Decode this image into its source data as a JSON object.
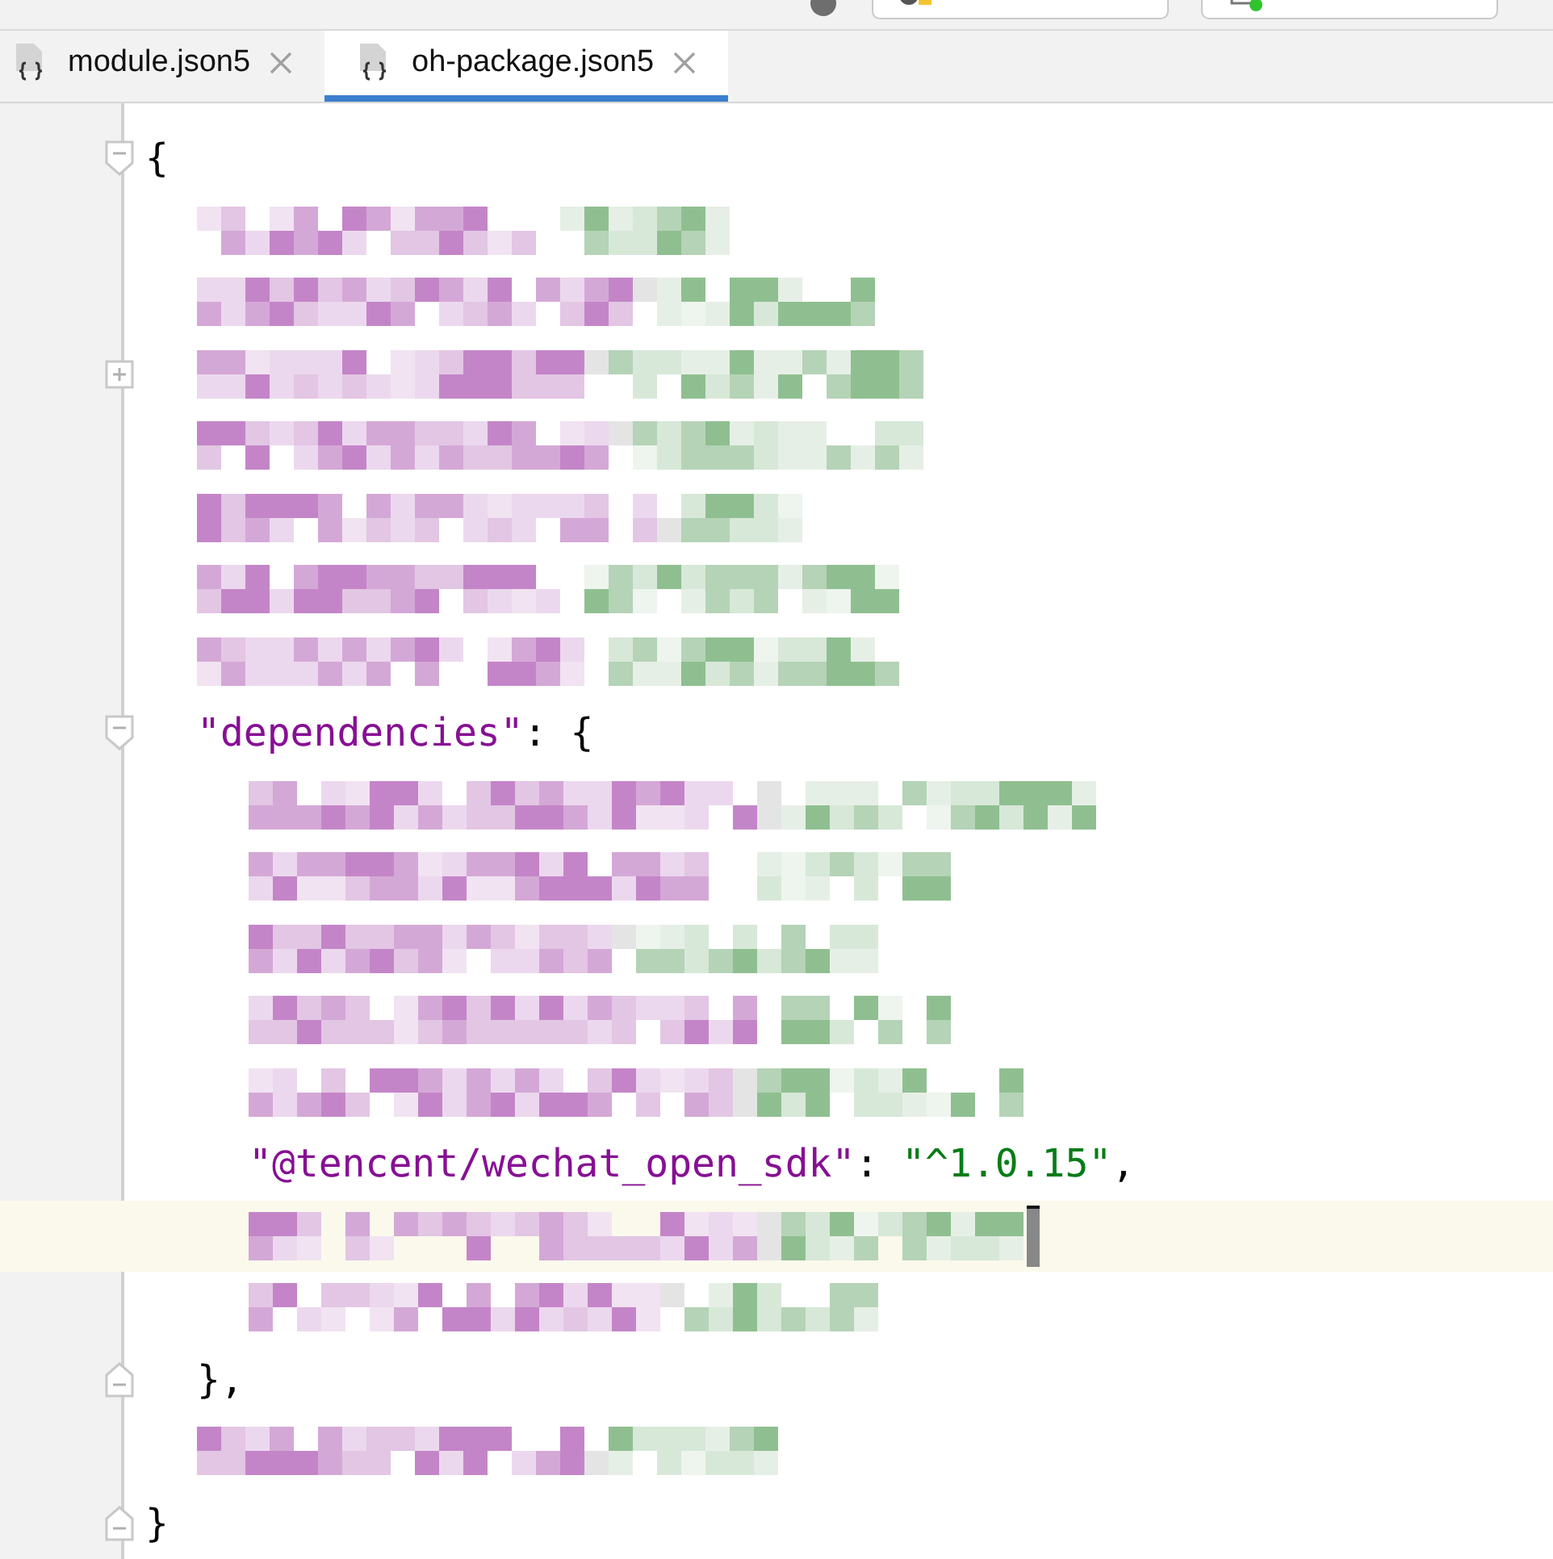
{
  "toolbar": {
    "devices": [
      {
        "kind": "phone"
      },
      {
        "kind": "device"
      }
    ]
  },
  "tabs": [
    {
      "label": "module.json5",
      "selected": false
    },
    {
      "label": "oh-package.json5",
      "selected": true
    }
  ],
  "editor": {
    "lines": [
      {
        "kind": "code",
        "gutter": {
          "kind": "open"
        },
        "current": false,
        "tokens": [
          {
            "color": "#080808",
            "text": "{"
          }
        ],
        "children": [
          {
            "kind": "obscured",
            "current": false
          },
          {
            "kind": "obscured",
            "current": false
          },
          {
            "kind": "obscured",
            "gutter": {
              "kind": "collapsed"
            },
            "current": false
          },
          {
            "kind": "obscured",
            "current": false
          },
          {
            "kind": "obscured",
            "current": false
          },
          {
            "kind": "obscured",
            "current": false
          },
          {
            "kind": "obscured",
            "current": false
          },
          {
            "kind": "code",
            "gutter": {
              "kind": "open"
            },
            "current": false,
            "tokens": [
              {
                "color": "#871094",
                "text": "\"dependencies\""
              },
              {
                "color": "#080808",
                "text": ": {"
              }
            ],
            "children": [
              {
                "kind": "obscured",
                "current": false
              },
              {
                "kind": "obscured",
                "current": false
              },
              {
                "kind": "obscured",
                "current": false
              },
              {
                "kind": "obscured",
                "current": false
              },
              {
                "kind": "obscured",
                "current": false
              },
              {
                "kind": "code",
                "current": false,
                "tokens": [
                  {
                    "color": "#871094",
                    "text": "\"@tencent/wechat_open_sdk\""
                  },
                  {
                    "color": "#080808",
                    "text": ": "
                  },
                  {
                    "color": "#067d17",
                    "text": "\"^1.0.15\""
                  },
                  {
                    "color": "#080808",
                    "text": ","
                  }
                ]
              },
              {
                "kind": "obscured",
                "current": true
              },
              {
                "kind": "obscured",
                "current": false
              }
            ]
          },
          {
            "kind": "code",
            "gutter": {
              "kind": "close"
            },
            "current": false,
            "tokens": [
              {
                "color": "#080808",
                "text": "},"
              }
            ]
          },
          {
            "kind": "obscured",
            "current": false
          }
        ]
      },
      {
        "kind": "code",
        "gutter": {
          "kind": "close"
        },
        "current": false,
        "tokens": [
          {
            "color": "#080808",
            "text": "}"
          }
        ]
      }
    ]
  }
}
